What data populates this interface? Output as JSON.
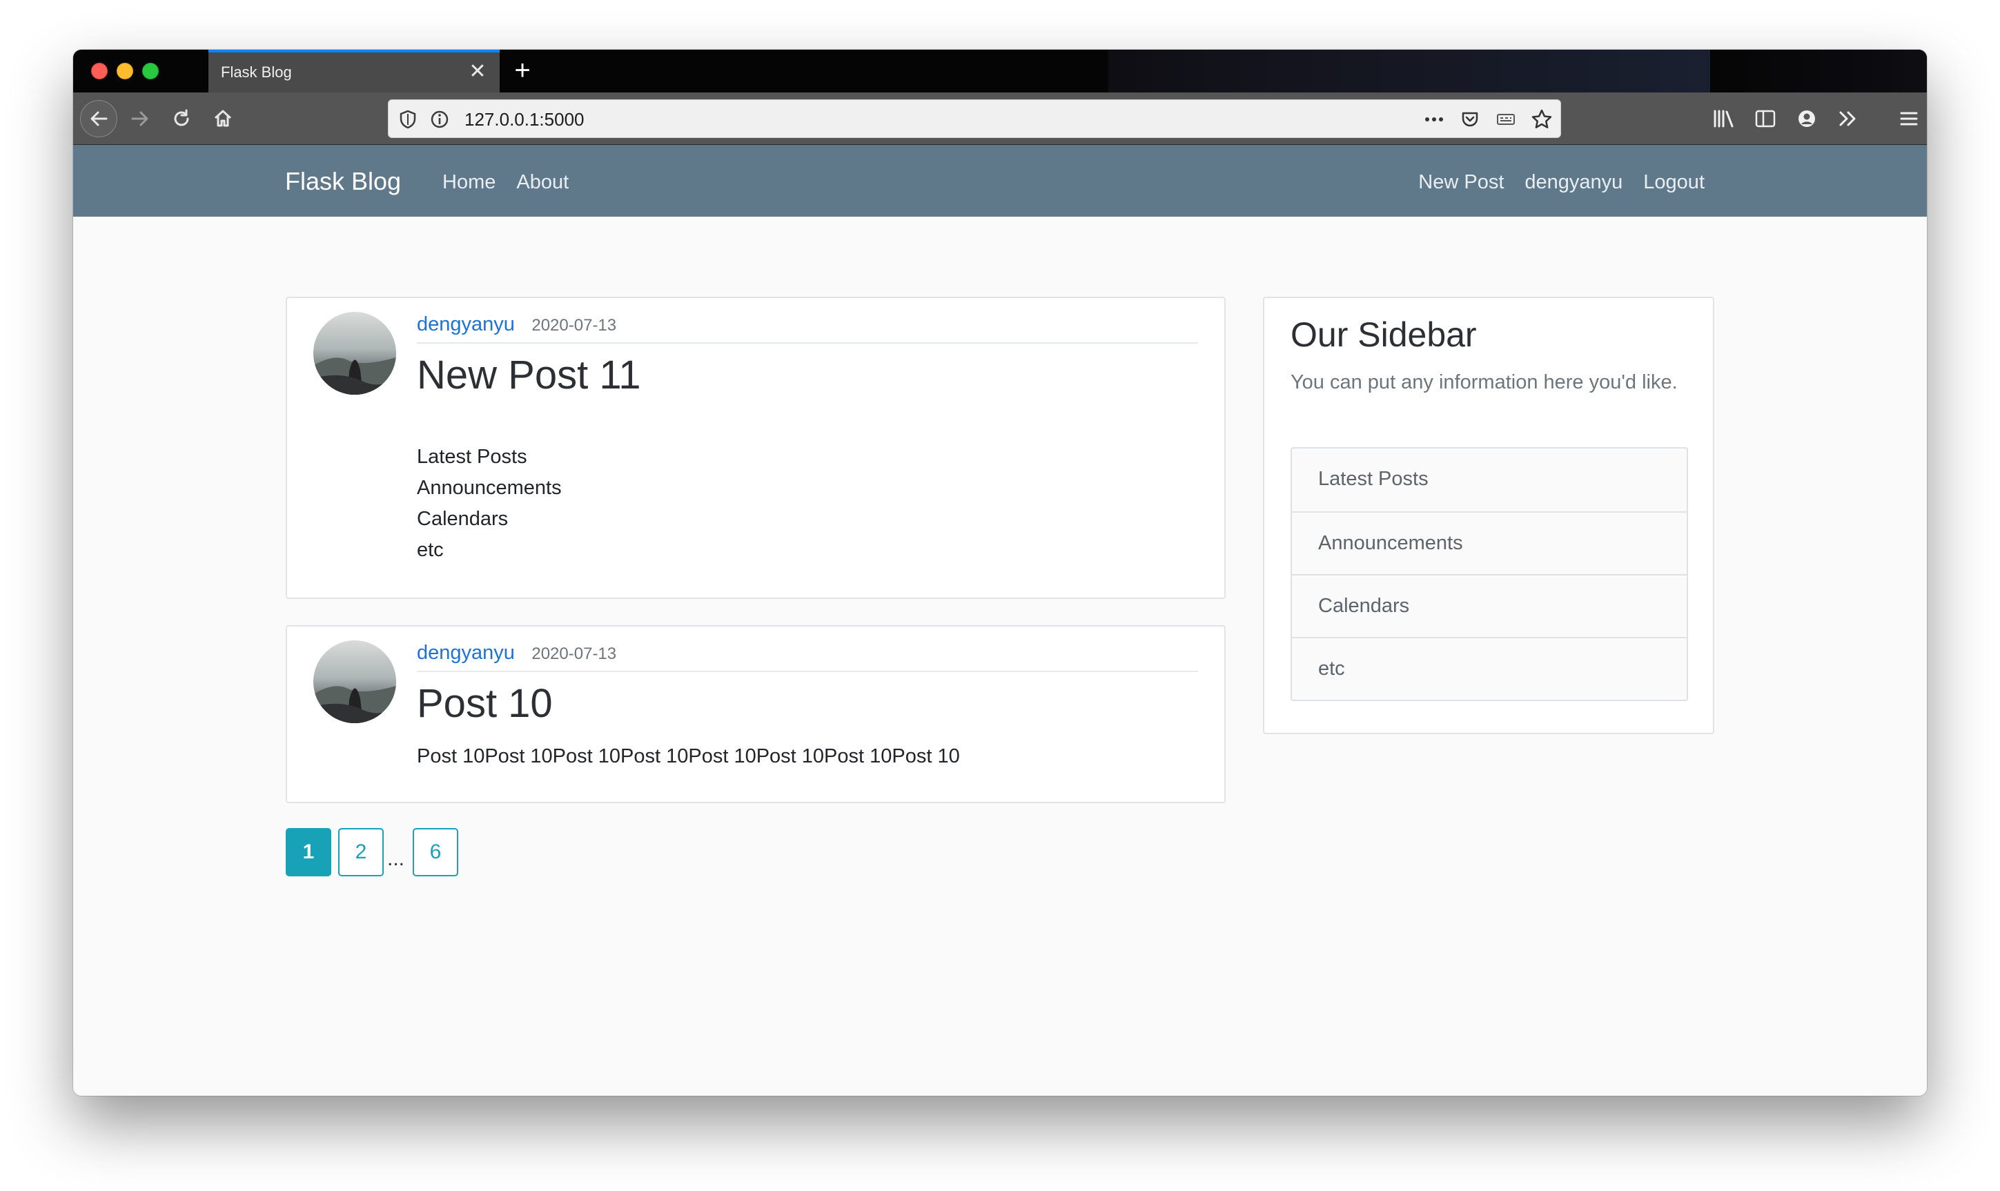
{
  "browser": {
    "tab_title": "Flask Blog",
    "url": "127.0.0.1:5000"
  },
  "navbar": {
    "brand": "Flask Blog",
    "left_links": [
      "Home",
      "About"
    ],
    "right_links": [
      "New Post",
      "dengyanyu",
      "Logout"
    ]
  },
  "posts": [
    {
      "author": "dengyanyu",
      "date": "2020-07-13",
      "title": "New Post 11",
      "body_lines": [
        "Latest Posts",
        "Announcements",
        "Calendars",
        "etc"
      ]
    },
    {
      "author": "dengyanyu",
      "date": "2020-07-13",
      "title": "Post 10",
      "body_lines": [
        "Post 10Post 10Post 10Post 10Post 10Post 10Post 10Post 10"
      ]
    }
  ],
  "pagination": {
    "pages": [
      "1",
      "2",
      "6"
    ],
    "ellipsis": "...",
    "current": "1"
  },
  "sidebar": {
    "title": "Our Sidebar",
    "description": "You can put any information here you'd like.",
    "items": [
      "Latest Posts",
      "Announcements",
      "Calendars",
      "etc"
    ]
  },
  "icons": {
    "close": "close-icon",
    "new_tab": "plus-icon",
    "back": "back-arrow-icon",
    "forward": "forward-arrow-icon",
    "reload": "reload-icon",
    "home": "home-icon"
  },
  "colors": {
    "navbar": "#5f788a",
    "link": "#1a73d9",
    "pagination": "#17a2b8"
  }
}
